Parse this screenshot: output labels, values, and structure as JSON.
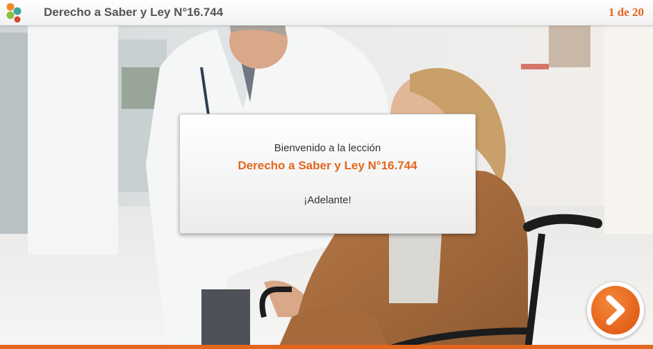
{
  "header": {
    "title": "Derecho a Saber y Ley N°16.744",
    "page_counter": "1 de 20"
  },
  "dialog": {
    "welcome": "Bienvenido a la lección",
    "lesson_title": "Derecho a Saber y Ley N°16.744",
    "go": "¡Adelante!"
  },
  "icons": {
    "logo": "four-dot-logo-icon",
    "next": "chevron-right-icon"
  },
  "colors": {
    "accent": "#e2661d",
    "logo_orange": "#f08a24",
    "logo_teal": "#3aa6a0",
    "logo_green": "#8bbf3f",
    "logo_red": "#d9452b"
  }
}
